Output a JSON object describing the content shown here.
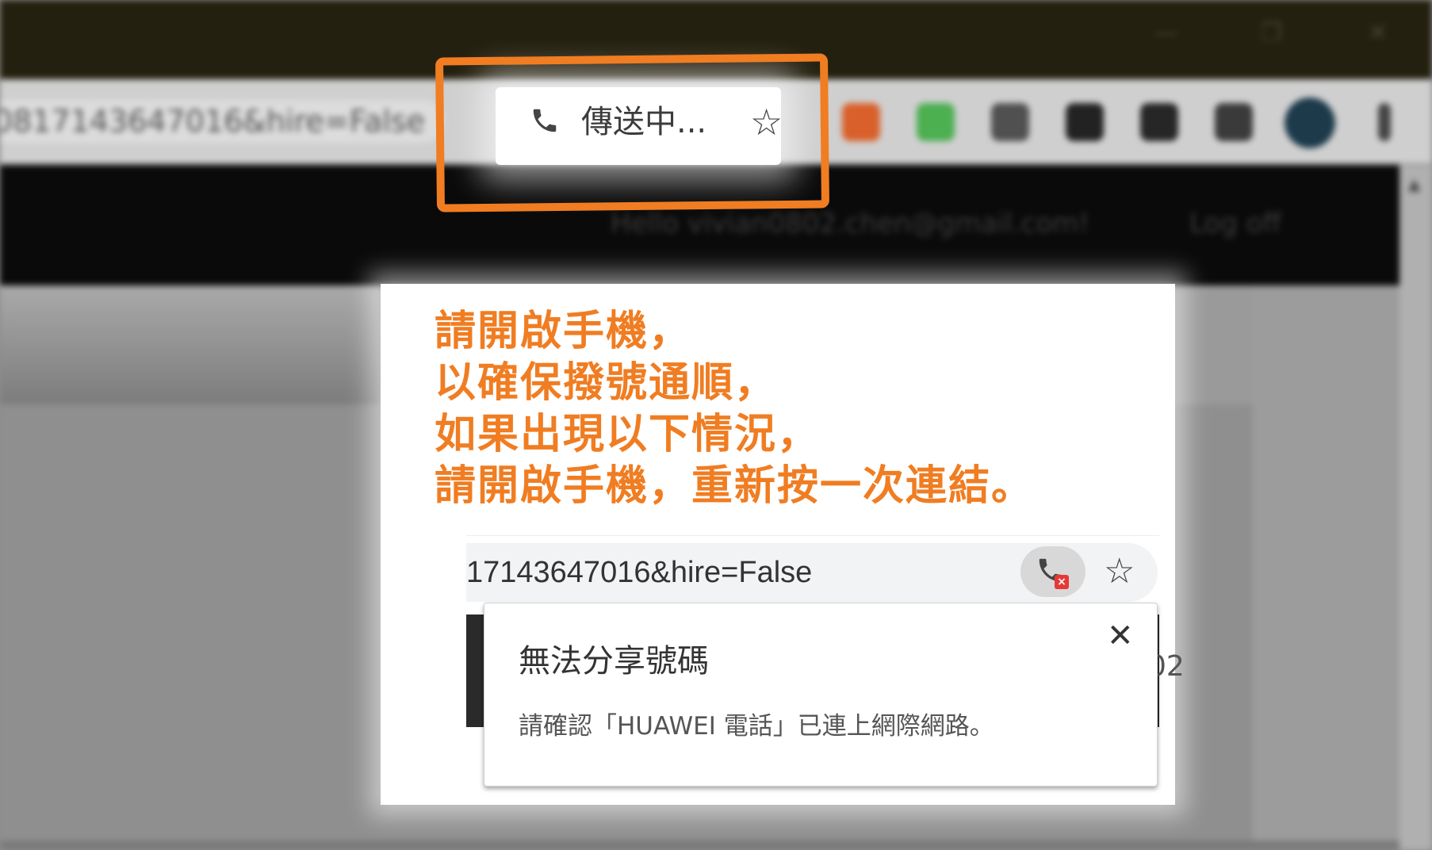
{
  "browser": {
    "url_fragment": "0817143647016&hire=False",
    "header_greeting": "Hello vivian0802.chen@gmail.com!",
    "logoff_label": "Log off",
    "window_controls": {
      "minimize": "—",
      "maximize": "❐",
      "close": "✕"
    }
  },
  "omnibox_highlight": {
    "status_text": "傳送中...",
    "phone_icon": "phone-icon",
    "star_icon": "star-icon",
    "highlight_color": "#f07d22"
  },
  "instructions": {
    "line1": "請開啟手機，",
    "line2": "以確保撥號通順，",
    "line3": "如果出現以下情況，",
    "line4": "請開啟手機，重新按一次連結。",
    "color": "#f07d22"
  },
  "example": {
    "url_text": "17143647016&hire=False",
    "error_badge": "×",
    "dark_strip_text": "02",
    "dialog": {
      "title": "無法分享號碼",
      "body": "請確認「HUAWEI 電話」已連上網際網路。",
      "close_symbol": "✕"
    }
  }
}
